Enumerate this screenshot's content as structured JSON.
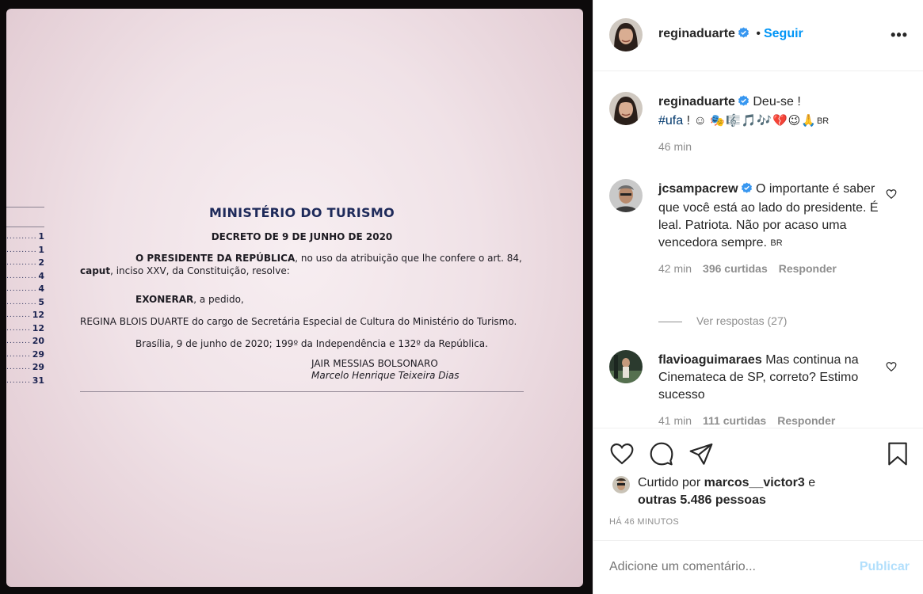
{
  "post_image": {
    "toc_numbers": [
      "1",
      "1",
      "2",
      "4",
      "4",
      "5",
      "12",
      "12",
      "20",
      "29",
      "29",
      "31"
    ],
    "doc_title": "MINISTÉRIO DO TURISMO",
    "doc_subtitle": "DECRETO DE 9 DE JUNHO DE 2020",
    "para1_bold": "O PRESIDENTE DA REPÚBLICA",
    "para1_text": ", no uso da atribuição que lhe confere o art. 84,",
    "para1_caput": "caput",
    "para1_text2": ", inciso XXV, da Constituição, resolve:",
    "para2_bold": "EXONERAR",
    "para2_text": ", a pedido,",
    "para3": "REGINA BLOIS DUARTE do cargo de Secretária Especial de Cultura do Ministério do Turismo.",
    "para4": "Brasília, 9 de junho de 2020; 199º da Independência e 132º da República.",
    "signer1": "JAIR MESSIAS BOLSONARO",
    "signer2": "Marcelo Henrique Teixeira Dias"
  },
  "header": {
    "username": "reginaduarte",
    "separator": "•",
    "follow_label": "Seguir",
    "more_label": "•••"
  },
  "caption": {
    "username": "reginaduarte",
    "text": "Deu-se !",
    "hashtag": "#ufa",
    "after_hashtag": " ! ☺",
    "emojis": "🎭🎼🎵🎶💔😉🙏",
    "region": "BR",
    "time": "46 min"
  },
  "comments": [
    {
      "username": "jcsampacrew",
      "text": "O importante é saber que você está ao lado do presidente. É leal. Patriota. Não por acaso uma vencedora sempre.",
      "region": "BR",
      "time": "42 min",
      "likes": "396 curtidas",
      "reply_label": "Responder",
      "view_replies": "Ver respostas (27)"
    },
    {
      "username": "flavioaguimaraes",
      "text": "Mas continua na Cinemateca de SP, correto? Estimo sucesso",
      "time": "41 min",
      "likes": "111 curtidas",
      "reply_label": "Responder"
    }
  ],
  "likes_summary": {
    "prefix": "Curtido por",
    "user": "marcos__victor3",
    "conjunction": "e",
    "others": "outras 5.486 pessoas"
  },
  "time_ago": "HÁ 46 MINUTOS",
  "add_comment": {
    "placeholder": "Adicione um comentário...",
    "post_label": "Publicar"
  },
  "colors": {
    "accent_blue": "#0095f6",
    "verified_blue": "#3897f0",
    "muted_gray": "#8e8e8e",
    "post_disabled": "#b2dffc"
  }
}
